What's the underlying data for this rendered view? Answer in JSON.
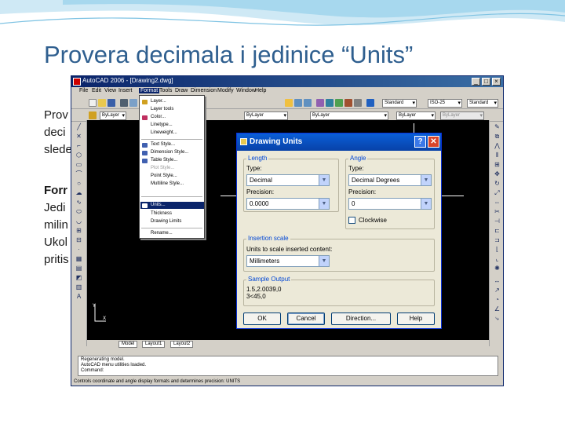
{
  "slide": {
    "title": "Provera decimala i jedinice “Units”",
    "bullets": [
      "Prov",
      "deci",
      "slede",
      "Forr",
      "Jedi",
      "milin",
      "Ukol",
      "pritis"
    ]
  },
  "acad": {
    "title": "AutoCAD 2006 - [Drawing2.dwg]",
    "menu": [
      "File",
      "Edit",
      "View",
      "Insert",
      "Format",
      "Tools",
      "Draw",
      "Dimension",
      "Modify",
      "Window",
      "Help"
    ],
    "active_menu": "Format",
    "layer_combo": "ByLayer",
    "linetype_combo": "ByLayer",
    "style_combo": "Standard",
    "dim_combo": "ISO-25",
    "format_menu": [
      "Layer...",
      "Layer tools",
      "Color...",
      "Linetype...",
      "Lineweight...",
      "Text Style...",
      "Dimension Style...",
      "Table Style...",
      "Plot Style...",
      "Point Style...",
      "Multiline Style...",
      "Units...",
      "Thickness",
      "Drawing Limits",
      "Rename..."
    ],
    "layout_tabs": [
      "Model",
      "Layout1",
      "Layout2"
    ],
    "command_lines": [
      "Regenerating model.",
      "AutoCAD menu utilities loaded.",
      "Command:"
    ],
    "status": "Controls coordinate and angle display formats and determines precision: UNITS"
  },
  "dialog": {
    "title": "Drawing Units",
    "help": "?",
    "close": "✕",
    "length_group": "Length",
    "length_type_label": "Type:",
    "length_type_value": "Decimal",
    "length_precision_label": "Precision:",
    "length_precision_value": "0.0000",
    "angle_group": "Angle",
    "angle_type_label": "Type:",
    "angle_type_value": "Decimal Degrees",
    "angle_precision_label": "Precision:",
    "angle_precision_value": "0",
    "clockwise_label": "Clockwise",
    "insertion_group": "Insertion scale",
    "insertion_label": "Units to scale inserted content:",
    "insertion_value": "Millimeters",
    "sample_group": "Sample Output",
    "sample_lines": [
      "1.5,2.0039,0",
      "3<45,0"
    ],
    "buttons": {
      "ok": "OK",
      "cancel": "Cancel",
      "direction": "Direction...",
      "help": "Help"
    }
  }
}
